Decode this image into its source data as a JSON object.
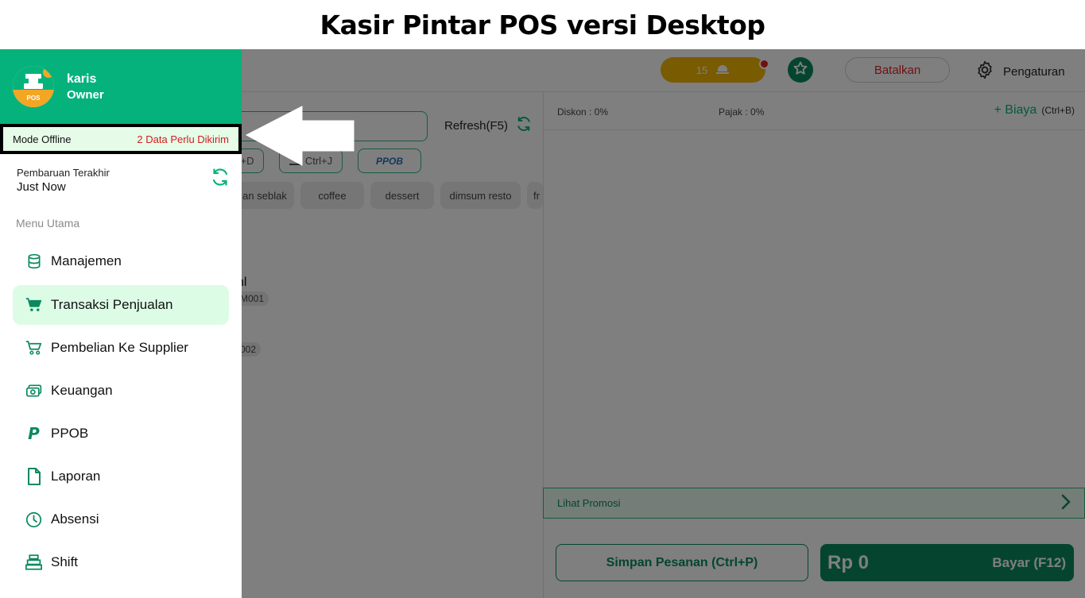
{
  "banner": {
    "title": "Kasir Pintar POS versi Desktop"
  },
  "topbar": {
    "notif_count": "15",
    "cancel_label": "Batalkan",
    "settings_label": "Pengaturan"
  },
  "main": {
    "refresh_label": "Refresh(F5)",
    "shortcut_chips": [
      "+D",
      "Ctrl+J",
      "PPOB"
    ],
    "categories": [
      "an seblak",
      "coffee",
      "dessert",
      "dimsum resto",
      "fr"
    ],
    "products": [
      {
        "name": "nl",
        "code": "M001"
      },
      {
        "name": "",
        "code": "002"
      }
    ]
  },
  "order": {
    "discount": "Diskon : 0%",
    "tax": "Pajak : 0%",
    "fee_label": "+ Biaya",
    "fee_shortcut": "(Ctrl+B)",
    "promo_label": "Lihat Promosi",
    "save_label": "Simpan Pesanan (Ctrl+P)",
    "total": "Rp 0",
    "pay_label": "Bayar (F12)"
  },
  "drawer": {
    "user_name": "karis",
    "user_role": "Owner",
    "avatar_badge": "POS",
    "offline_label": "Mode Offline",
    "offline_count": "2 Data Perlu Dikirim",
    "update_title": "Pembaruan Terakhir",
    "update_value": "Just Now",
    "section_title": "Menu Utama",
    "menu": [
      {
        "label": "Manajemen",
        "icon": "database-icon"
      },
      {
        "label": "Transaksi Penjualan",
        "icon": "cart-filled-icon"
      },
      {
        "label": "Pembelian Ke Supplier",
        "icon": "cart-outline-icon"
      },
      {
        "label": "Keuangan",
        "icon": "cash-icon"
      },
      {
        "label": "PPOB",
        "icon": "ppob-icon"
      },
      {
        "label": "Laporan",
        "icon": "document-icon"
      },
      {
        "label": "Absensi",
        "icon": "clock-icon"
      },
      {
        "label": "Shift",
        "icon": "register-icon"
      }
    ]
  },
  "colors": {
    "brand_green": "#06b27b",
    "dark_green": "#0a8a5e",
    "warning": "#f2b705",
    "danger": "#d01f1f"
  }
}
